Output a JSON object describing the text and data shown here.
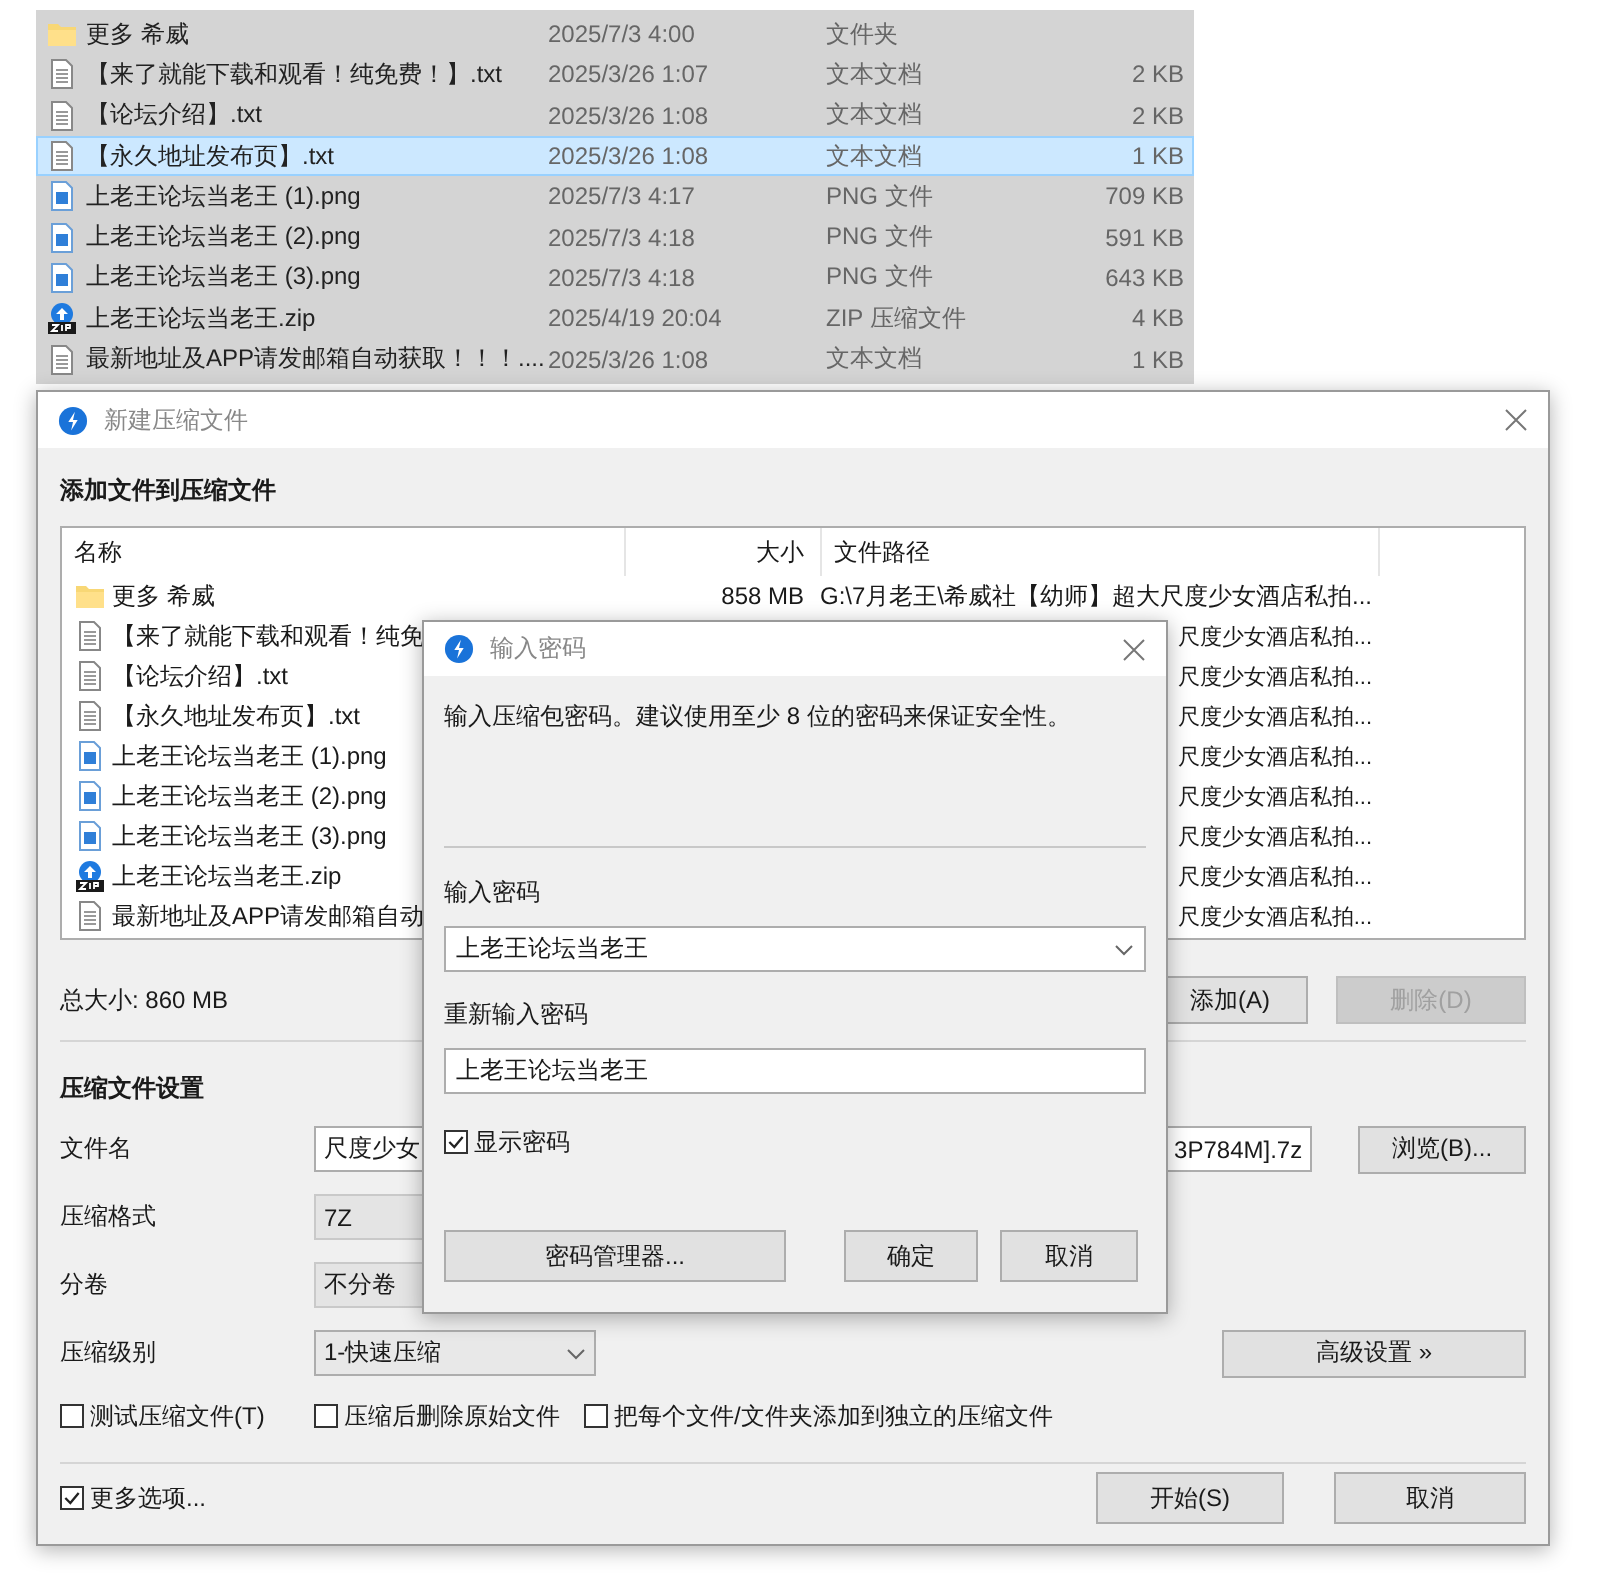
{
  "explorer": {
    "rows": [
      {
        "kind": "folder",
        "name": "更多 希威",
        "date": "2025/7/3 4:00",
        "type": "文件夹",
        "selected": false
      },
      {
        "kind": "text",
        "name": "【来了就能下载和观看！纯免费！】.txt",
        "date": "2025/3/26 1:07",
        "type": "文本文档",
        "size": "2 KB",
        "selected": false
      },
      {
        "kind": "text",
        "name": "【论坛介绍】.txt",
        "date": "2025/3/26 1:08",
        "type": "文本文档",
        "size": "2 KB",
        "selected": false
      },
      {
        "kind": "text",
        "name": "【永久地址发布页】.txt",
        "date": "2025/3/26 1:08",
        "type": "文本文档",
        "size": "1 KB",
        "selected": true
      },
      {
        "kind": "image",
        "name": "上老王论坛当老王 (1).png",
        "date": "2025/7/3 4:17",
        "type": "PNG 文件",
        "size": "709 KB",
        "selected": false
      },
      {
        "kind": "image",
        "name": "上老王论坛当老王 (2).png",
        "date": "2025/7/3 4:18",
        "type": "PNG 文件",
        "size": "591 KB",
        "selected": false
      },
      {
        "kind": "image",
        "name": "上老王论坛当老王 (3).png",
        "date": "2025/7/3 4:18",
        "type": "PNG 文件",
        "size": "643 KB",
        "selected": false
      },
      {
        "kind": "zip",
        "name": "上老王论坛当老王.zip",
        "date": "2025/4/19 20:04",
        "type": "ZIP 压缩文件",
        "size": "4 KB",
        "selected": false
      },
      {
        "kind": "text",
        "name": "最新地址及APP请发邮箱自动获取！！！....",
        "date": "2025/3/26 1:08",
        "type": "文本文档",
        "size": "1 KB",
        "selected": false
      }
    ]
  },
  "dialog": {
    "title": "新建压缩文件",
    "section_title": "添加文件到压缩文件",
    "file_list": {
      "columns": [
        "名称",
        "大小",
        "文件路径"
      ],
      "rows": [
        {
          "kind": "folder",
          "name": "更多 希威",
          "size": "858 MB",
          "path": "G:\\7月老王\\希威社【幼师】超大尺度少女酒店私拍..."
        },
        {
          "kind": "text",
          "name": "【来了就能下载和观看！纯免",
          "path": "尺度少女酒店私拍..."
        },
        {
          "kind": "text",
          "name": "【论坛介绍】.txt",
          "path": "尺度少女酒店私拍..."
        },
        {
          "kind": "text",
          "name": "【永久地址发布页】.txt",
          "path": "尺度少女酒店私拍..."
        },
        {
          "kind": "image",
          "name": "上老王论坛当老王 (1).png",
          "path": "尺度少女酒店私拍..."
        },
        {
          "kind": "image",
          "name": "上老王论坛当老王 (2).png",
          "path": "尺度少女酒店私拍..."
        },
        {
          "kind": "image",
          "name": "上老王论坛当老王 (3).png",
          "path": "尺度少女酒店私拍..."
        },
        {
          "kind": "zip",
          "name": "上老王论坛当老王.zip",
          "path": "尺度少女酒店私拍..."
        },
        {
          "kind": "text",
          "name": "最新地址及APP请发邮箱自动",
          "path": "尺度少女酒店私拍..."
        }
      ]
    },
    "total_size": "总大小: 860 MB",
    "list_buttons": [
      {
        "label": "添加(A)",
        "disabled": false
      },
      {
        "label": "删除(D)",
        "disabled": true
      }
    ],
    "settings_title": "压缩文件设置",
    "fields": [
      {
        "kind": "text",
        "label": "文件名",
        "value": "尺度少女",
        "value_end": "3P784M].7z",
        "button": "浏览(B)..."
      },
      {
        "kind": "box",
        "label": "压缩格式",
        "value": "7Z"
      },
      {
        "kind": "box",
        "label": "分卷",
        "value": "不分卷"
      },
      {
        "kind": "dropdown",
        "label": "压缩级别",
        "value": "1-快速压缩",
        "button": "高级设置 »"
      }
    ],
    "options": [
      {
        "label": "测试压缩文件(T)",
        "checked": false
      },
      {
        "label": "压缩后删除原始文件",
        "checked": false
      },
      {
        "label": "把每个文件/文件夹添加到独立的压缩文件",
        "checked": false
      }
    ],
    "more_options": {
      "label": "更多选项...",
      "checked": true
    },
    "footer_buttons": [
      "开始(S)",
      "取消"
    ]
  },
  "password_dialog": {
    "title": "输入密码",
    "message": "输入压缩包密码。建议使用至少 8 位的密码来保证安全性。",
    "password_label": "输入密码",
    "password": "上老王论坛当老王",
    "confirm_label": "重新输入密码",
    "confirm": "上老王论坛当老王",
    "show_password": {
      "label": "显示密码",
      "checked": true
    },
    "buttons": [
      "密码管理器...",
      "确定",
      "取消"
    ]
  }
}
